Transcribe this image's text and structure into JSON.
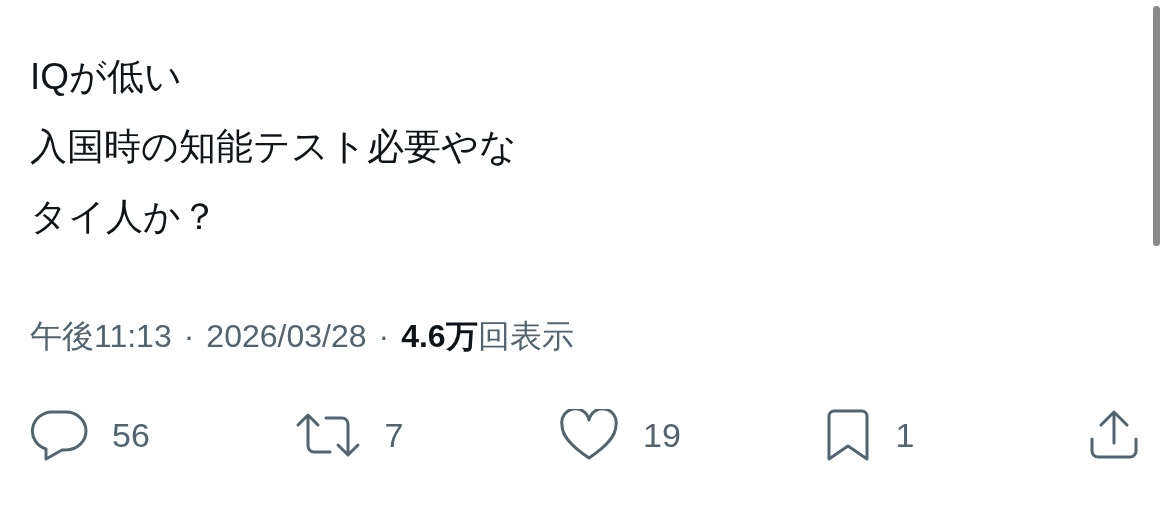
{
  "tweet": {
    "lines": [
      "IQが低い",
      "入国時の知能テスト必要やな",
      "タイ人か？"
    ]
  },
  "meta": {
    "time": "午後11:13",
    "separator_1": "·",
    "date": "2026/03/28",
    "separator_2": "·",
    "views_count": "4.6万",
    "views_label": "回表示"
  },
  "actions": [
    {
      "kind": "reply",
      "count": "56"
    },
    {
      "kind": "repost",
      "count": "7"
    },
    {
      "kind": "like",
      "count": "19"
    },
    {
      "kind": "bookmark",
      "count": "1"
    },
    {
      "kind": "share"
    }
  ]
}
